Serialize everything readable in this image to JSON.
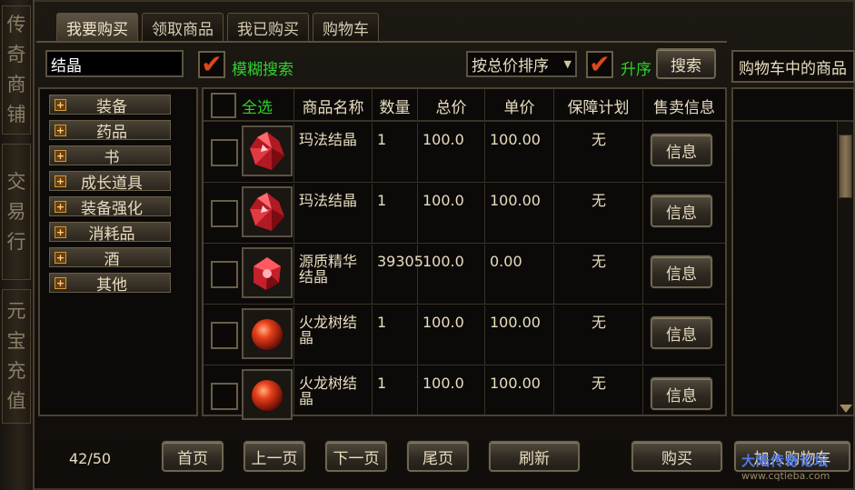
{
  "side_tabs": [
    {
      "label": "传奇商铺",
      "chars": [
        "传",
        "奇",
        "商",
        "铺"
      ]
    },
    {
      "label": "交易行",
      "chars": [
        "交",
        "易",
        "行"
      ]
    },
    {
      "label": "元宝充值",
      "chars": [
        "元",
        "宝",
        "充",
        "值"
      ]
    }
  ],
  "tabs": [
    {
      "label": "我要购买",
      "active": true
    },
    {
      "label": "领取商品",
      "active": false
    },
    {
      "label": "我已购买",
      "active": false
    },
    {
      "label": "购物车",
      "active": false
    }
  ],
  "search": {
    "value": "结晶",
    "fuzzy_checked": true,
    "fuzzy_label": "模糊搜索",
    "sort_selected": "按总价排序",
    "asc_checked": true,
    "asc_label": "升序",
    "search_button": "搜索"
  },
  "cart": {
    "title": "购物车中的商品"
  },
  "categories": [
    "装备",
    "药品",
    "书",
    "成长道具",
    "装备强化",
    "消耗品",
    "酒",
    "其他"
  ],
  "table": {
    "select_all": "全选",
    "headers": [
      "商品名称",
      "数量",
      "总价",
      "单价",
      "保障计划",
      "售卖信息"
    ],
    "rows": [
      {
        "name": "玛法结晶",
        "qty": "1",
        "total": "100.0",
        "unit": "100.00",
        "guarantee": "无",
        "info": "信息",
        "icon": "red-crystal-icon"
      },
      {
        "name": "玛法结晶",
        "qty": "1",
        "total": "100.0",
        "unit": "100.00",
        "guarantee": "无",
        "info": "信息",
        "icon": "red-crystal-icon"
      },
      {
        "name": "源质精华结晶",
        "qty": "39305",
        "total": "100.0",
        "unit": "0.00",
        "guarantee": "无",
        "info": "信息",
        "icon": "red-gem-icon"
      },
      {
        "name": "火龙树结晶",
        "qty": "1",
        "total": "100.0",
        "unit": "100.00",
        "guarantee": "无",
        "info": "信息",
        "icon": "red-orb-icon"
      },
      {
        "name": "火龙树结晶",
        "qty": "1",
        "total": "100.0",
        "unit": "100.00",
        "guarantee": "无",
        "info": "信息",
        "icon": "red-orb-icon"
      }
    ]
  },
  "pagination": {
    "page": "42/50",
    "first": "首页",
    "prev": "上一页",
    "next": "下一页",
    "last": "尾页",
    "refresh": "刷新"
  },
  "actions": {
    "buy": "购买",
    "add_to_cart": "加入购物车"
  },
  "watermark": {
    "line1": "大陆传奇论坛",
    "line2": "www.cqtieba.com"
  }
}
